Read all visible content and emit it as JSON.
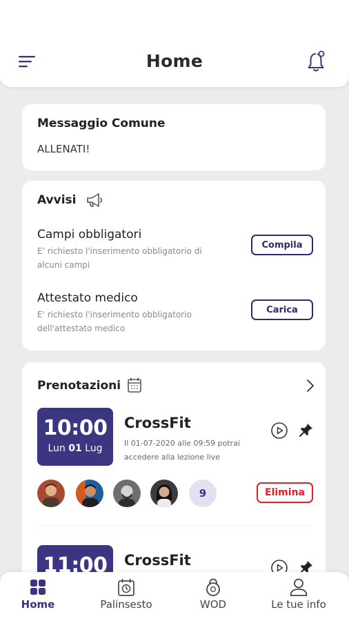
{
  "header": {
    "title": "Home",
    "menu_icon": "hamburger-menu-icon",
    "notification_icon": "bell-icon"
  },
  "common_message": {
    "heading": "Messaggio Comune",
    "text": "ALLENATI!"
  },
  "notices": {
    "heading": "Avvisi",
    "icon": "megaphone-icon",
    "items": [
      {
        "title": "Campi obbligatori",
        "description": "E' richiesto l'inserimento obbligatorio di alcuni campi",
        "button": "Compila"
      },
      {
        "title": "Attestato medico",
        "description": "E' richiesto l'inserimento obbligatorio dell'attestato medico",
        "button": "Carica"
      }
    ]
  },
  "bookings": {
    "heading": "Prenotazioni",
    "icon": "calendar-icon",
    "items": [
      {
        "time": "10:00",
        "day": "Lun",
        "date_num": "01",
        "month": "Lug",
        "class_name": "CrossFit",
        "info": "Il 01-07-2020 alle 09:59 potrai accedere alla lezione live",
        "participants_more": "9",
        "delete_label": "Elimina"
      },
      {
        "time": "11:00",
        "class_name": "CrossFit"
      }
    ]
  },
  "tabbar": {
    "tabs": [
      {
        "label": "Home",
        "icon": "home-grid-icon",
        "active": true
      },
      {
        "label": "Palinsesto",
        "icon": "schedule-calendar-icon",
        "active": false
      },
      {
        "label": "WOD",
        "icon": "kettlebell-icon",
        "active": false
      },
      {
        "label": "Le tue info",
        "icon": "user-profile-icon",
        "active": false
      }
    ]
  },
  "colors": {
    "accent": "#3b3582",
    "danger": "#e21d24",
    "background": "#ececec"
  }
}
